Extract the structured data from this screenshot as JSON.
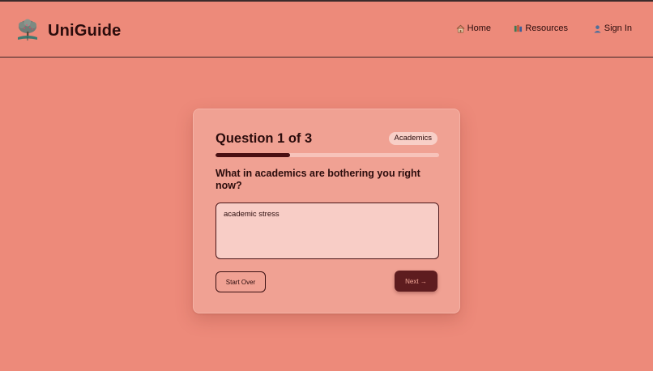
{
  "header": {
    "brand_name": "UniGuide",
    "nav": [
      {
        "label": "Home",
        "icon": "house-icon"
      },
      {
        "label": "Resources",
        "icon": "books-icon"
      },
      {
        "label": "Sign In",
        "icon": "user-icon"
      }
    ]
  },
  "quiz": {
    "title": "Question 1 of 3",
    "category": "Academics",
    "progress_fraction": 0.333,
    "question": "What in academics are bothering you right now?",
    "answer_value": "academic stress",
    "start_over_label": "Start Over",
    "next_label": "Next →"
  },
  "colors": {
    "background": "#ed8a7a",
    "card": "#f0a193",
    "accent_dark": "#5e1c1f",
    "progress_fill": "#4a0f12",
    "progress_track": "#f7c3ba"
  }
}
